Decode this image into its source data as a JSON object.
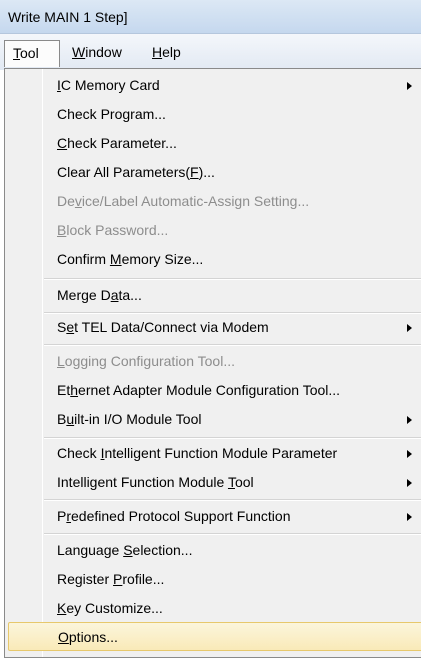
{
  "title": "Write MAIN 1 Step]",
  "menubar": {
    "tool": {
      "a": "",
      "u": "T",
      "b": "ool"
    },
    "window": {
      "a": "",
      "u": "W",
      "b": "indow"
    },
    "help": {
      "a": "",
      "u": "H",
      "b": "elp"
    }
  },
  "menu": {
    "items": [
      {
        "a": "",
        "u": "I",
        "b": "C Memory Card"
      },
      {
        "a": "Check Pro",
        "u": "g",
        "b": "ram..."
      },
      {
        "a": "",
        "u": "C",
        "b": "heck Parameter..."
      },
      {
        "a": "Clear All Parameters(",
        "u": "F",
        "b": ")..."
      },
      {
        "a": "De",
        "u": "v",
        "b": "ice/Label Automatic-Assign Setting..."
      },
      {
        "a": "",
        "u": "B",
        "b": "lock Password..."
      },
      {
        "a": "Confirm ",
        "u": "M",
        "b": "emory Size..."
      },
      {
        "a": "Merge D",
        "u": "a",
        "b": "ta..."
      },
      {
        "a": "S",
        "u": "e",
        "b": "t TEL Data/Connect via Modem"
      },
      {
        "a": "",
        "u": "L",
        "b": "ogging Configuration Tool..."
      },
      {
        "a": "Et",
        "u": "h",
        "b": "ernet Adapter Module Configuration Tool..."
      },
      {
        "a": "B",
        "u": "u",
        "b": "ilt-in I/O Module Tool"
      },
      {
        "a": "Check ",
        "u": "I",
        "b": "ntelligent Function Module Parameter"
      },
      {
        "a": "Intelligent Function Module ",
        "u": "T",
        "b": "ool"
      },
      {
        "a": "P",
        "u": "r",
        "b": "edefined Protocol Support Function"
      },
      {
        "a": "Language ",
        "u": "S",
        "b": "election..."
      },
      {
        "a": "Register ",
        "u": "P",
        "b": "rofile..."
      },
      {
        "a": "",
        "u": "K",
        "b": "ey Customize..."
      },
      {
        "a": "",
        "u": "O",
        "b": "ptions..."
      }
    ]
  }
}
